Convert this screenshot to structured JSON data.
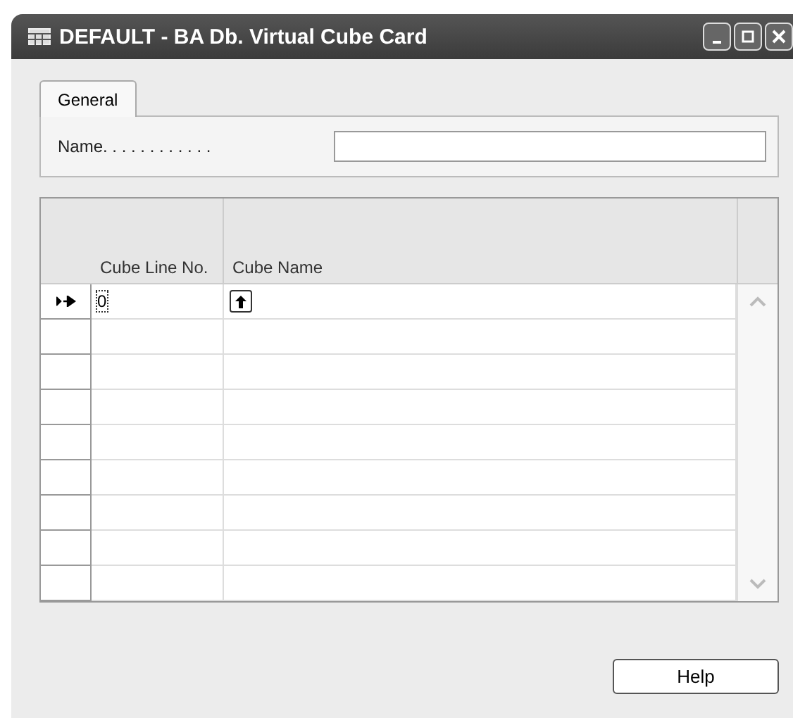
{
  "window": {
    "title": "DEFAULT - BA Db. Virtual Cube Card"
  },
  "tabs": [
    {
      "label": "General",
      "selected": true
    }
  ],
  "fields": [
    {
      "label": "Name. . . . . . . . . . . ."
    }
  ],
  "table": {
    "columns": [
      "Cube Line No.",
      "Cube Name"
    ],
    "rows": [
      {
        "current": true,
        "cube_line_no": "0"
      },
      {
        "current": false
      },
      {
        "current": false
      },
      {
        "current": false
      },
      {
        "current": false
      },
      {
        "current": false
      },
      {
        "current": false
      },
      {
        "current": false
      },
      {
        "current": false
      }
    ]
  },
  "buttons": [
    "Help"
  ]
}
